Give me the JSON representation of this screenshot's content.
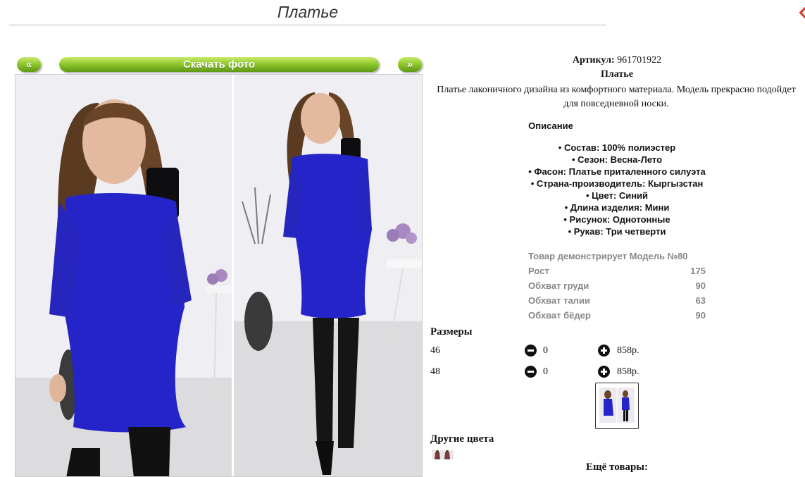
{
  "header": {
    "title": "Платье"
  },
  "gallery": {
    "prev_label": "«",
    "download_label": "Скачать фото",
    "next_label": "»"
  },
  "product": {
    "sku_label": "Артикул:",
    "sku_value": "961701922",
    "name": "Платье",
    "description": "Платье лаконичного дизайна из комфортного материала. Модель прекрасно подойдет для повседневной носки."
  },
  "details": {
    "heading": "Описание",
    "items": [
      "• Состав: 100% полиэстер",
      "• Сезон: Весна-Лето",
      "• Фасон: Платье приталенного силуэта",
      "• Страна-производитель: Кыргызстан",
      "• Цвет: Синий",
      "• Длина изделия: Мини",
      "• Рисунок: Однотонные",
      "• Рукав: Три четверти"
    ]
  },
  "model": {
    "rows": [
      {
        "label": "Товар демонстрирует Модель №80",
        "value": ""
      },
      {
        "label": "Рост",
        "value": "175"
      },
      {
        "label": "Обхват груди",
        "value": "90"
      },
      {
        "label": "Обхват талии",
        "value": "63"
      },
      {
        "label": "Обхват бёдер",
        "value": "90"
      }
    ]
  },
  "sizes": {
    "heading": "Размеры",
    "rows": [
      {
        "size": "46",
        "qty": "0",
        "price": "858р."
      },
      {
        "size": "48",
        "qty": "0",
        "price": "858р."
      }
    ]
  },
  "other_colors": {
    "heading": "Другие цвета"
  },
  "more": {
    "heading": "Ещё товары:"
  },
  "colors": {
    "accent_green": "#8cc52a",
    "dress_blue": "#2424c8",
    "close_red": "#d43a2b"
  }
}
